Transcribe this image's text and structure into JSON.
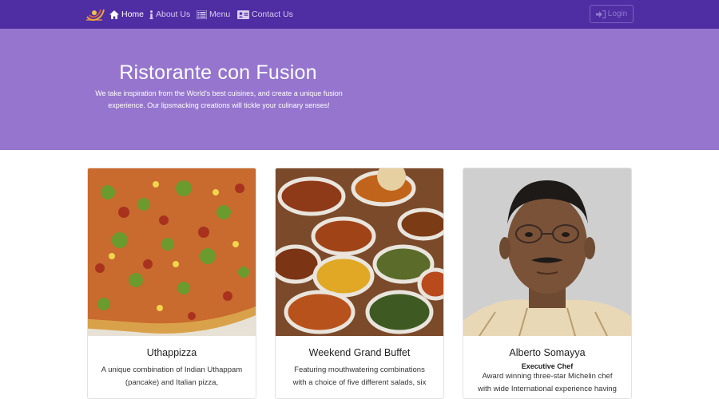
{
  "nav": {
    "items": [
      {
        "label": "Home",
        "icon": "home-icon",
        "active": true
      },
      {
        "label": "About Us",
        "icon": "info-icon",
        "active": false
      },
      {
        "label": "Menu",
        "icon": "list-icon",
        "active": false
      },
      {
        "label": "Contact Us",
        "icon": "address-card-icon",
        "active": false
      }
    ],
    "login_label": "Login",
    "brand_icon": "restaurant-logo-icon"
  },
  "hero": {
    "title": "Ristorante con Fusion",
    "description": "We take inspiration from the World's best cuisines, and create a unique fusion experience. Our lipsmacking creations will tickle your culinary senses!"
  },
  "cards": [
    {
      "title": "Uthappizza",
      "subtitle": "",
      "text": "A unique combination of Indian Uthappam (pancake) and Italian pizza,"
    },
    {
      "title": "Weekend Grand Buffet",
      "subtitle": "",
      "text": "Featuring mouthwatering combinations with a choice of five different salads, six"
    },
    {
      "title": "Alberto Somayya",
      "subtitle": "Executive Chef",
      "text": "Award winning three-star Michelin chef with wide International experience having"
    }
  ],
  "colors": {
    "navbar": "#4f2da3",
    "jumbotron": "#9575cd",
    "text_on_primary": "#ffffff"
  }
}
